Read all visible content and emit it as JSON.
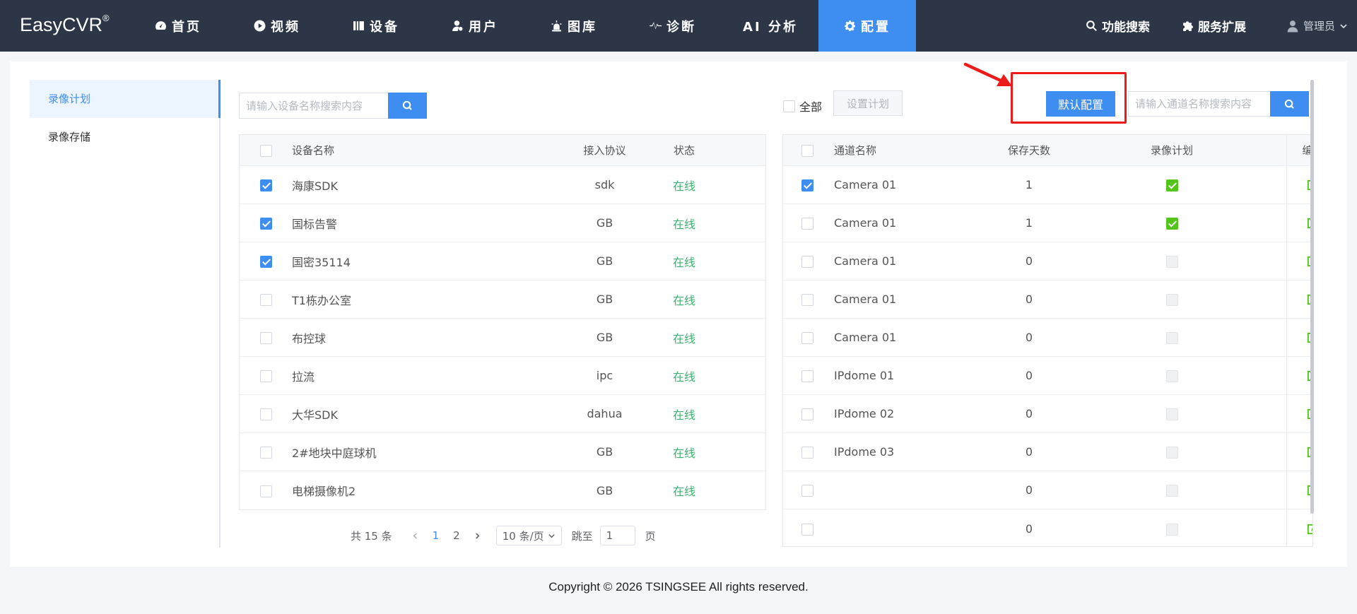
{
  "app": {
    "logo": "EasyCVR",
    "logo_mark": "®"
  },
  "nav": {
    "items": [
      {
        "label": "首页",
        "icon": "dashboard-icon",
        "active": false
      },
      {
        "label": "视频",
        "icon": "play-icon",
        "active": false
      },
      {
        "label": "设备",
        "icon": "device-icon",
        "active": false
      },
      {
        "label": "用户",
        "icon": "user-icon",
        "active": false
      },
      {
        "label": "图库",
        "icon": "alarm-light-icon",
        "active": false
      },
      {
        "label": "诊断",
        "icon": "pulse-icon",
        "active": false
      },
      {
        "label": "AI 分析",
        "icon": "",
        "active": false
      },
      {
        "label": "配置",
        "icon": "gear-icon",
        "active": true
      }
    ],
    "func_search": "功能搜索",
    "service_ext": "服务扩展",
    "admin": "管理员"
  },
  "sidebar": {
    "items": [
      {
        "label": "录像计划",
        "active": true
      },
      {
        "label": "录像存储",
        "active": false
      }
    ]
  },
  "device_search": {
    "placeholder": "请输入设备名称搜索内容",
    "value": ""
  },
  "channel_search": {
    "placeholder": "请输入通道名称搜索内容",
    "value": ""
  },
  "controls": {
    "all_label": "全部",
    "set_plan": "设置计划",
    "default_config": "默认配置"
  },
  "device_table": {
    "headers": {
      "name": "设备名称",
      "protocol": "接入协议",
      "status": "状态"
    },
    "rows": [
      {
        "checked": true,
        "name": "海康SDK",
        "protocol": "sdk",
        "status": "在线"
      },
      {
        "checked": true,
        "name": "国标告警",
        "protocol": "GB",
        "status": "在线"
      },
      {
        "checked": true,
        "name": "国密35114",
        "protocol": "GB",
        "status": "在线"
      },
      {
        "checked": false,
        "name": "T1栋办公室",
        "protocol": "GB",
        "status": "在线"
      },
      {
        "checked": false,
        "name": "布控球",
        "protocol": "GB",
        "status": "在线"
      },
      {
        "checked": false,
        "name": "拉流",
        "protocol": "ipc",
        "status": "在线"
      },
      {
        "checked": false,
        "name": "大华SDK",
        "protocol": "dahua",
        "status": "在线"
      },
      {
        "checked": false,
        "name": "2#地块中庭球机",
        "protocol": "GB",
        "status": "在线"
      },
      {
        "checked": false,
        "name": "电梯摄像机2",
        "protocol": "GB",
        "status": "在线"
      }
    ]
  },
  "channel_table": {
    "headers": {
      "name": "通道名称",
      "days": "保存天数",
      "plan": "录像计划",
      "edit": "编辑"
    },
    "rows": [
      {
        "checked": true,
        "name": "Camera 01",
        "days": "1",
        "plan": true
      },
      {
        "checked": false,
        "name": "Camera 01",
        "days": "1",
        "plan": true
      },
      {
        "checked": false,
        "name": "Camera 01",
        "days": "0",
        "plan": false
      },
      {
        "checked": false,
        "name": "Camera 01",
        "days": "0",
        "plan": false
      },
      {
        "checked": false,
        "name": "Camera 01",
        "days": "0",
        "plan": false
      },
      {
        "checked": false,
        "name": "IPdome 01",
        "days": "0",
        "plan": false
      },
      {
        "checked": false,
        "name": "IPdome 02",
        "days": "0",
        "plan": false
      },
      {
        "checked": false,
        "name": "IPdome 03",
        "days": "0",
        "plan": false
      },
      {
        "checked": false,
        "name": "",
        "days": "0",
        "plan": false
      },
      {
        "checked": false,
        "name": "",
        "days": "0",
        "plan": false
      }
    ]
  },
  "pager": {
    "total": "共 15 条",
    "pages": [
      "1",
      "2"
    ],
    "current": "1",
    "page_size": "10 条/页",
    "jump_label": "跳至",
    "jump_value": "1",
    "page_suffix": "页"
  },
  "annotation": {
    "color": "#ee1b1b"
  },
  "footer": {
    "text": "Copyright © 2026 TSINGSEE All rights reserved."
  },
  "colors": {
    "nav_bg": "#2c3646",
    "accent": "#3d8ef0",
    "online": "#3cb371",
    "plan_on": "#52c41a"
  }
}
